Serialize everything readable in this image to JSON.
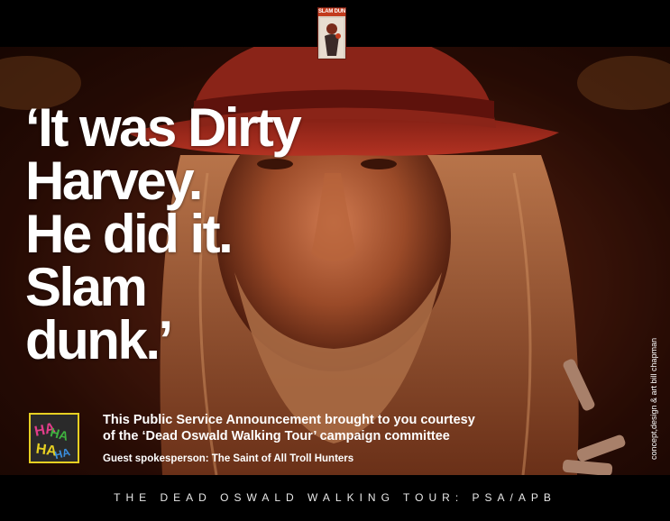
{
  "logo": {
    "title": "SLAM DUNK"
  },
  "headline": {
    "lines": [
      "‘It was Dirty",
      "Harvey.",
      "He did it.",
      "Slam",
      "dunk.’"
    ]
  },
  "credit": "concept,design & art bill chapman",
  "badge": {
    "label": "HAHA"
  },
  "psa": {
    "line1": "This Public Service Announcement brought to you courtesy",
    "line2": "of the ‘Dead Oswald Walking Tour’ campaign committee",
    "guest": "Guest spokesperson: The Saint of All Troll Hunters"
  },
  "footer": "THE DEAD OSWALD WALKING TOUR: PSA/APB",
  "colors": {
    "background": "#000000",
    "hat_red": "#9a2a1c",
    "text": "#ffffff",
    "logo_red": "#c23b1d",
    "badge_yellow": "#e6cf22"
  }
}
